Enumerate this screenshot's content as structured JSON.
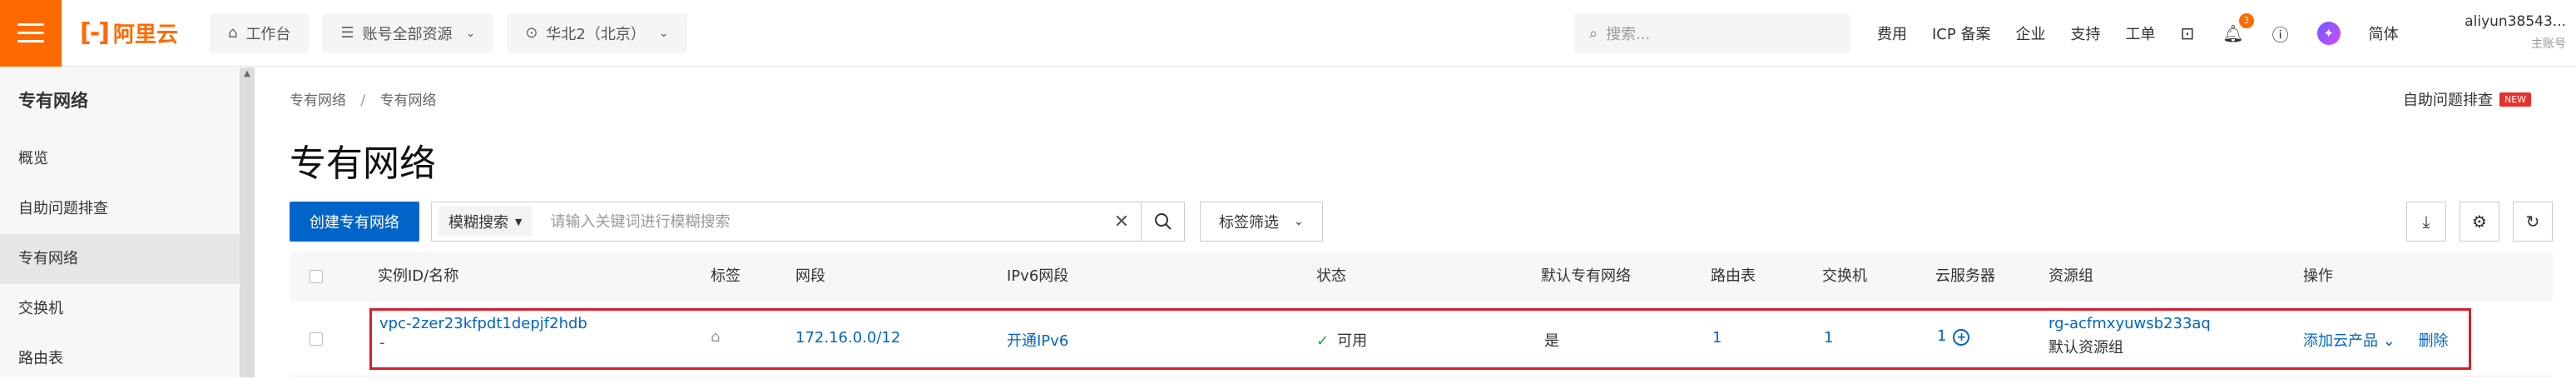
{
  "brand": {
    "logo_mark": "[-]",
    "logo_text": "阿里云",
    "color": "#ff6a00"
  },
  "topbar": {
    "workbench": "工作台",
    "resources": "账号全部资源",
    "region": "华北2（北京）",
    "search_placeholder": "搜索...",
    "links": {
      "fee": "费用",
      "icp": "ICP 备案",
      "enterprise": "企业",
      "support": "支持",
      "ticket": "工单",
      "lang": "简体"
    },
    "notification_count": "3",
    "account_name": "aliyun38543...",
    "account_sub": "主账号"
  },
  "sidebar": {
    "title": "专有网络",
    "items": [
      {
        "label": "概览"
      },
      {
        "label": "自助问题排查"
      },
      {
        "label": "专有网络"
      },
      {
        "label": "交换机"
      },
      {
        "label": "路由表"
      }
    ]
  },
  "breadcrumb": {
    "root": "专有网络",
    "current": "专有网络"
  },
  "help": {
    "label": "自助问题排查",
    "badge": "NEW"
  },
  "page_title": "专有网络",
  "toolbar": {
    "create_label": "创建专有网络",
    "search_type": "模糊搜索",
    "search_placeholder": "请输入关键词进行模糊搜索",
    "tag_filter": "标签筛选"
  },
  "table": {
    "columns": {
      "id": "实例ID/名称",
      "tags": "标签",
      "cidr": "网段",
      "ipv6": "IPv6网段",
      "status": "状态",
      "default": "默认专有网络",
      "route": "路由表",
      "switch": "交换机",
      "ecs": "云服务器",
      "rg": "资源组",
      "actions": "操作"
    },
    "rows": [
      {
        "id": "vpc-2zer23kfpdt1depjf2hdb",
        "name": "-",
        "cidr": "172.16.0.0/12",
        "ipv6": "开通IPv6",
        "status": "可用",
        "default": "是",
        "route_count": "1",
        "switch_count": "1",
        "ecs_count": "1",
        "rg_id": "rg-acfmxyuwsb233aq",
        "rg_name": "默认资源组",
        "action_add": "添加云产品",
        "action_delete": "删除"
      }
    ]
  }
}
